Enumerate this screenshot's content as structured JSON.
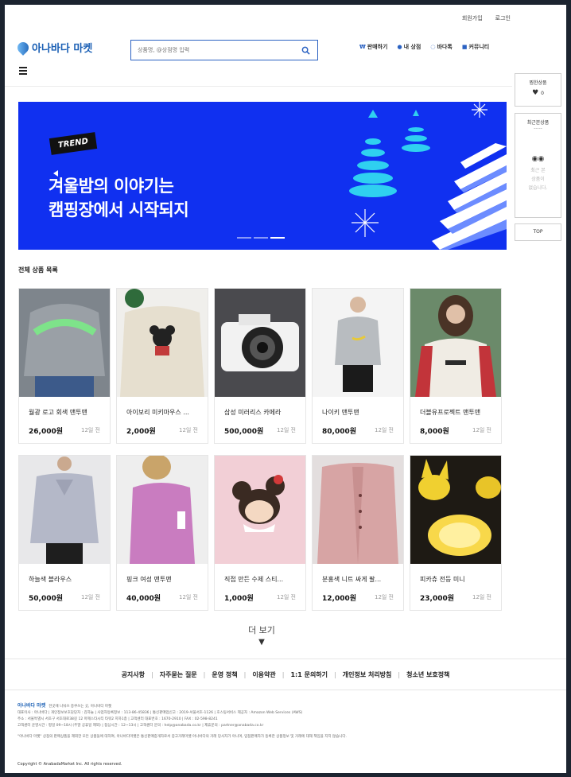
{
  "util": {
    "signup": "회원가입",
    "login": "로그인"
  },
  "header": {
    "logo": "아나바다 마켓",
    "search_placeholder": "상품명, @상점명 입력",
    "nav": [
      {
        "label": "판매하기",
        "icon": "won-icon"
      },
      {
        "label": "내 상점",
        "icon": "person-icon"
      },
      {
        "label": "바다톡",
        "icon": "chat-icon"
      },
      {
        "label": "커뮤니티",
        "icon": "board-icon"
      }
    ]
  },
  "banner": {
    "badge": "TREND",
    "line1": "겨울밤의 이야기는",
    "line2": "캠핑장에서 시작되지",
    "color": "#1030f0"
  },
  "sidebar": {
    "liked_title": "찜한상품",
    "liked_count": "0",
    "recent_title": "최근본상품",
    "recent_dash": "-----",
    "recent_empty": [
      "최근 본",
      "상품이",
      "없습니다."
    ],
    "top": "TOP"
  },
  "section_title": "전체 상품 목록",
  "products": [
    {
      "name": "월광 로고 회색 맨투맨",
      "price": "26,000원",
      "ago": "12일 전"
    },
    {
      "name": "아이보리 미키마우스 ...",
      "price": "2,000원",
      "ago": "12일 전"
    },
    {
      "name": "삼성 미러리스 카메라",
      "price": "500,000원",
      "ago": "12일 전"
    },
    {
      "name": "나이키 맨투맨",
      "price": "80,000원",
      "ago": "12일 전"
    },
    {
      "name": "더블유프로젝트 맨투맨",
      "price": "8,000원",
      "ago": "12일 전"
    },
    {
      "name": "하늘색 블라우스",
      "price": "50,000원",
      "ago": "12일 전"
    },
    {
      "name": "핑크 여성 맨투맨",
      "price": "40,000원",
      "ago": "12일 전"
    },
    {
      "name": "직접 만든 수제 스티...",
      "price": "1,000원",
      "ago": "12일 전"
    },
    {
      "name": "분홍색 니트 싸게 팔...",
      "price": "12,000원",
      "ago": "12일 전"
    },
    {
      "name": "피카츄 전등 미니",
      "price": "23,000원",
      "ago": "12일 전"
    }
  ],
  "more": "더 보기",
  "footer_nav": [
    "공지사항",
    "자주묻는 질문",
    "운영 정책",
    "이용약관",
    "1:1 문의하기",
    "개인정보 처리방침",
    "청소년 보호정책"
  ],
  "footer": {
    "logo": "아나바다 마켓",
    "slogan": "한곳에 나눠쓰 중쿠쓰는 곳, 아나바다 마켓",
    "line1": "대표이사 : 아나바다 | 개인정보보호담당자 : 김하늘 | 사업자등록정보 : 113-86-45836 | 통신판매업신고 : 2019-서울서초-1126 | 호스팅서비스 제공자 : Amazon Web Services (AWS)",
    "line2": "주소 : 서울특별시 서초구 서초대로38길 12 마제스타시티 타워2 지하1층 | 고객센터 대표번호 : 1670-2910 | FAX : 02-598-8241",
    "line3": "고객센터 운영시간 : 평일 09~18시 (주말 공휴일 제외) | 점심시간 : 12~13시 | 고객센터 문의 : help@anabada.co.kr | 제휴문의 : partner@anabada.co.kr",
    "line4": "\"아나바다 마켓\" 상점의 판매상품을 제외한 모든 상품들에 대하여, 아나바다마켓은 통신판매중개자로서 중고거래마켓 아나바다의 거래 당사자가 아니며, 입점판매자가 등록한 상품정보 및 거래에 대해 책임을 지지 않습니다.",
    "copyright": "Copyright © AnabadaMarket Inc. All rights reserved."
  }
}
